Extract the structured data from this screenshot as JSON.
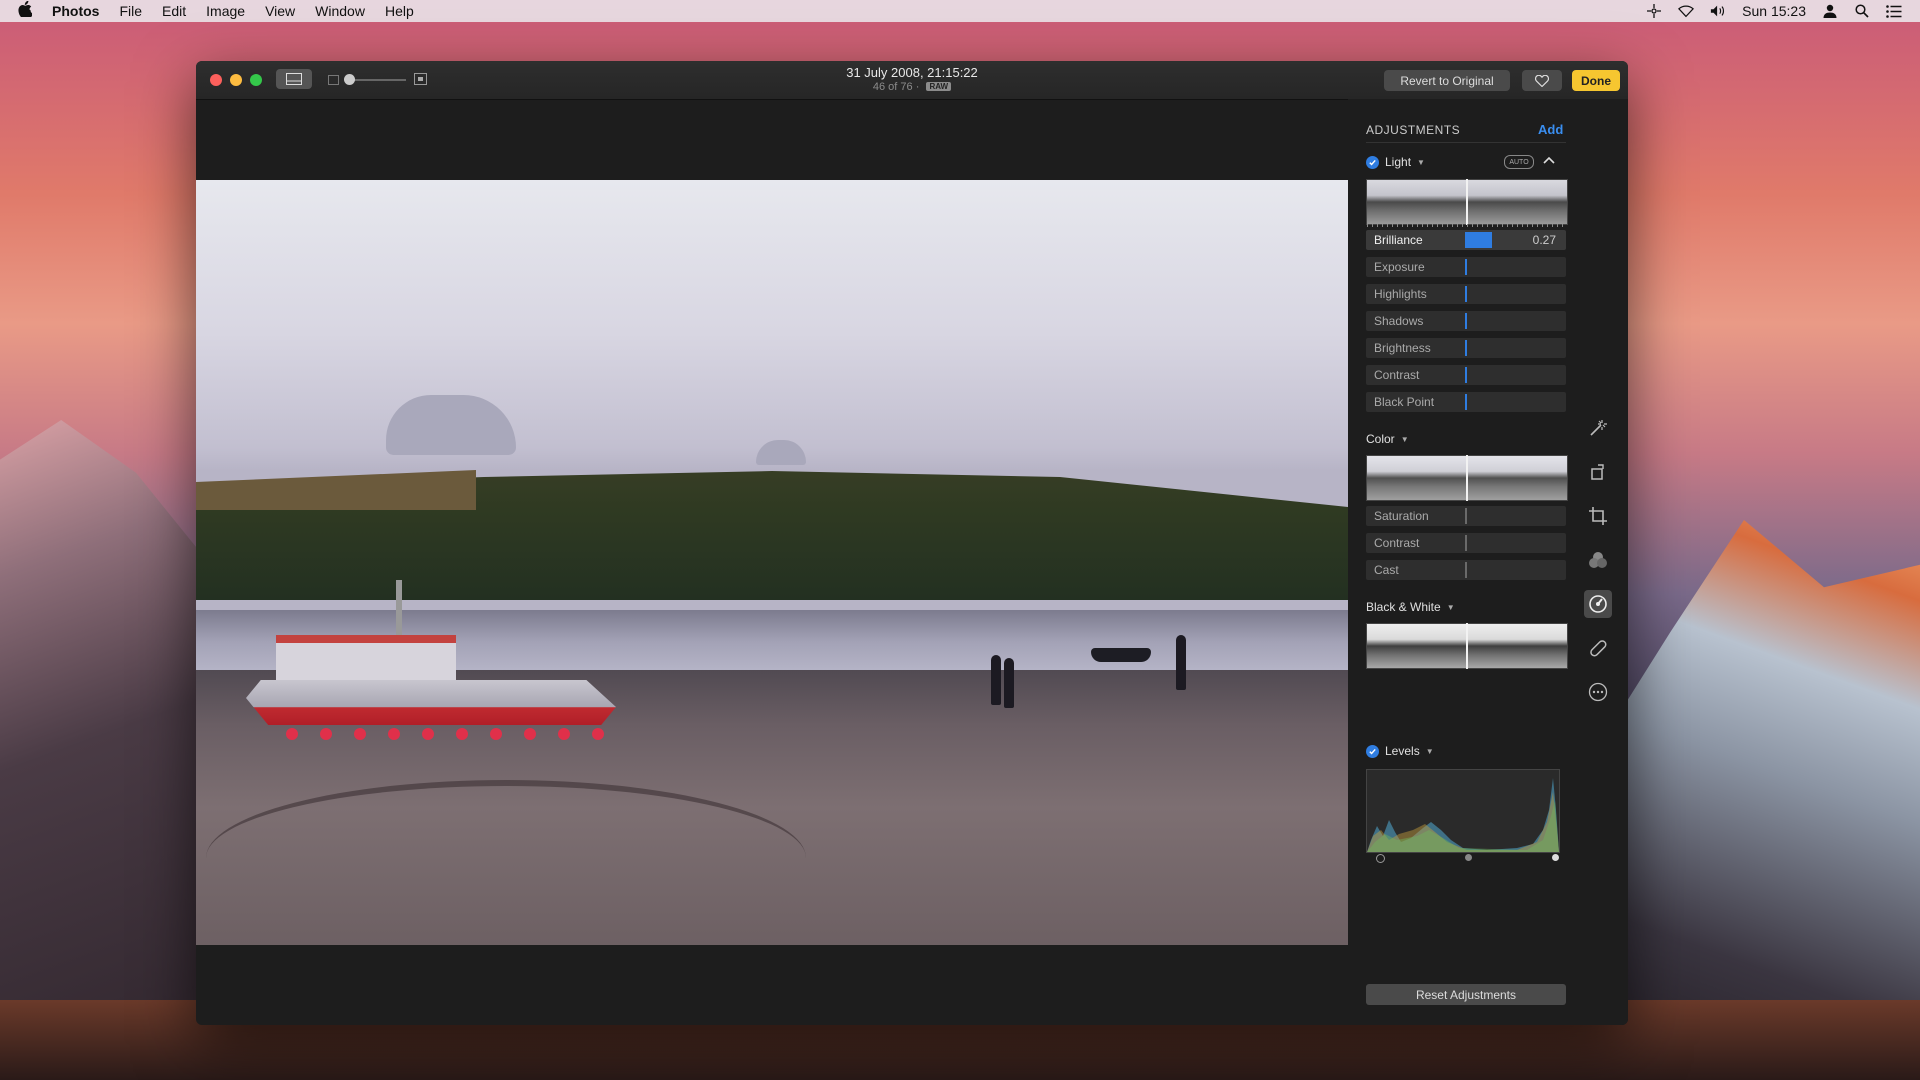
{
  "menubar": {
    "app_name": "Photos",
    "items": [
      "File",
      "Edit",
      "Image",
      "View",
      "Window",
      "Help"
    ],
    "clock": "Sun 15:23"
  },
  "window": {
    "title": "31 July 2008, 21:15:22",
    "subtitle": "46 of 76",
    "subtitle_separator": "·",
    "badge": "RAW",
    "revert_label": "Revert to Original",
    "done_label": "Done"
  },
  "adjustments": {
    "header": "ADJUSTMENTS",
    "add_label": "Add",
    "light": {
      "title": "Light",
      "auto_label": "AUTO",
      "sliders": [
        {
          "label": "Brilliance",
          "value": "0.27",
          "fill": 0.27
        },
        {
          "label": "Exposure"
        },
        {
          "label": "Highlights"
        },
        {
          "label": "Shadows"
        },
        {
          "label": "Brightness"
        },
        {
          "label": "Contrast"
        },
        {
          "label": "Black Point"
        }
      ]
    },
    "color": {
      "title": "Color",
      "sliders": [
        {
          "label": "Saturation"
        },
        {
          "label": "Contrast"
        },
        {
          "label": "Cast"
        }
      ]
    },
    "bw": {
      "title": "Black & White"
    },
    "levels": {
      "title": "Levels"
    },
    "reset_label": "Reset Adjustments"
  },
  "colors": {
    "accent_blue": "#2f7de1",
    "done_yellow": "#f6c630"
  }
}
